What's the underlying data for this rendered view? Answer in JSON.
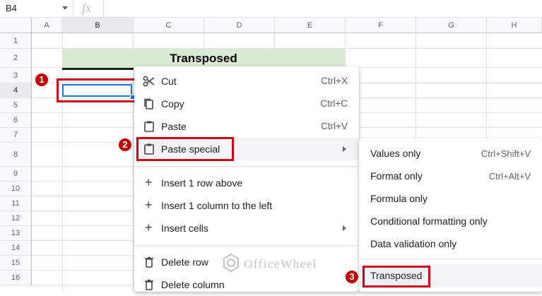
{
  "formula_bar": {
    "name_box": "B4",
    "fx_label": "fx"
  },
  "columns": [
    "A",
    "B",
    "C",
    "D",
    "E",
    "F",
    "G",
    "H"
  ],
  "rows": [
    "1",
    "2",
    "3",
    "4",
    "5",
    "6",
    "7",
    "8",
    "9",
    "10",
    "11",
    "12",
    "13",
    "14",
    "15",
    "16"
  ],
  "sheet": {
    "title_cell": "Transposed"
  },
  "context_menu": {
    "items": [
      {
        "label": "Cut",
        "shortcut": "Ctrl+X"
      },
      {
        "label": "Copy",
        "shortcut": "Ctrl+C"
      },
      {
        "label": "Paste",
        "shortcut": "Ctrl+V"
      },
      {
        "label": "Paste special"
      },
      {
        "label": "Insert 1 row above"
      },
      {
        "label": "Insert 1 column to the left"
      },
      {
        "label": "Insert cells"
      },
      {
        "label": "Delete row"
      },
      {
        "label": "Delete column"
      }
    ]
  },
  "paste_special_submenu": {
    "items": [
      {
        "label": "Values only",
        "shortcut": "Ctrl+Shift+V"
      },
      {
        "label": "Format only",
        "shortcut": "Ctrl+Alt+V"
      },
      {
        "label": "Formula only"
      },
      {
        "label": "Conditional formatting only"
      },
      {
        "label": "Data validation only"
      },
      {
        "label": "Transposed"
      }
    ]
  },
  "callouts": [
    "1",
    "2",
    "3"
  ],
  "watermark": {
    "text": "OfficeWheel"
  },
  "colors": {
    "accent": "#1a73e8",
    "callout_red": "#d0021b",
    "title_fill": "#d9ead3"
  }
}
